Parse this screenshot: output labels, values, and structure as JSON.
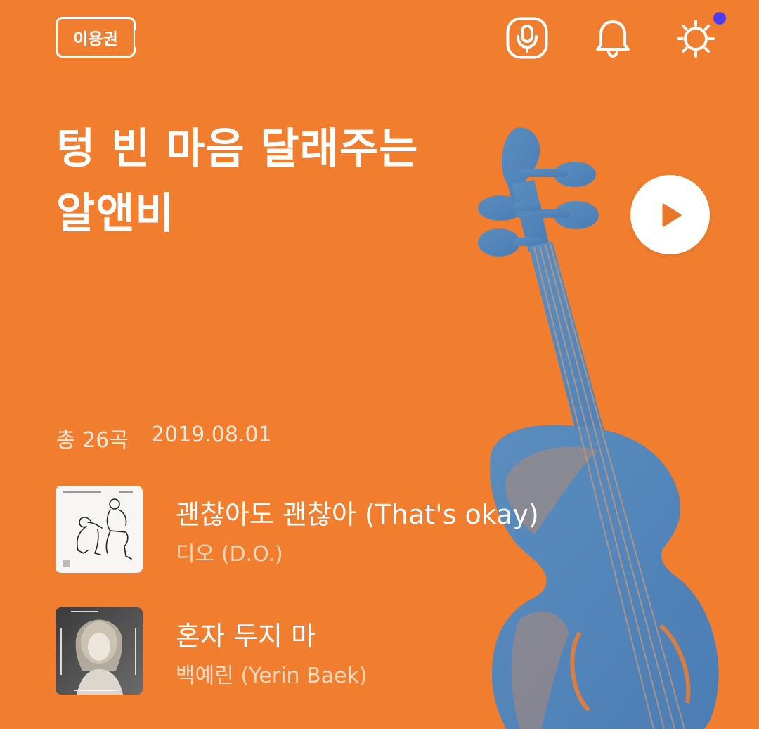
{
  "header": {
    "ticket_label": "이용권",
    "icons": [
      "mic-icon",
      "bell-icon",
      "settings-icon"
    ],
    "has_notification": true
  },
  "playlist": {
    "title_line1": "텅 빈 마음 달래주는",
    "title_line2": "알앤비",
    "track_count": "총 26곡",
    "date": "2019.08.01"
  },
  "tracks": [
    {
      "title": "괜찮아도 괜찮아 (That's okay)",
      "artist": "디오 (D.O.)"
    },
    {
      "title": "혼자 두지 마",
      "artist": "백예린 (Yerin Baek)"
    }
  ],
  "colors": {
    "background": "#F07E2E",
    "violin": "#3F86C9",
    "notification_dot": "#4A3DF5",
    "play_icon": "#E8762B"
  }
}
